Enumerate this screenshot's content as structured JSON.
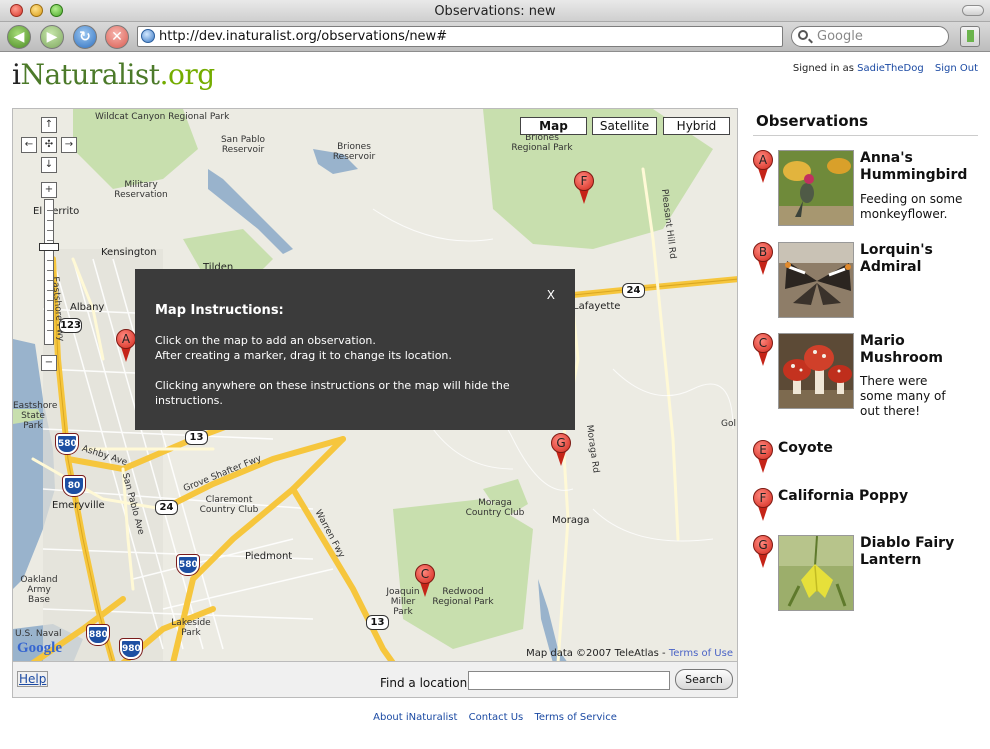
{
  "browser": {
    "window_title": "Observations: new",
    "url": "http://dev.inaturalist.org/observations/new#",
    "search_placeholder": "Google"
  },
  "header": {
    "logo_i": "i",
    "logo_nat": "Naturalist",
    "logo_org": ".org",
    "signed_in_prefix": "Signed in as",
    "username": "SadieTheDog",
    "sign_out": "Sign Out"
  },
  "map": {
    "type_buttons": [
      "Map",
      "Satellite",
      "Hybrid"
    ],
    "active_type": "Map",
    "pan": {
      "up": "↑",
      "left": "←",
      "center": "✣",
      "right": "→",
      "down": "↓"
    },
    "zoom_in": "+",
    "zoom_out": "−",
    "places": [
      "Wildcat Canyon Regional Park",
      "Briones Regional Park",
      "San Pablo Reservoir",
      "Briones Reservoir",
      "Military Reservation",
      "El Cerrito",
      "Kensington",
      "Tilden",
      "Albany",
      "Lafayette",
      "Moraga",
      "Moraga Country Club",
      "Emeryville",
      "Claremont Country Club",
      "Piedmont",
      "Joaquin Miller Park",
      "Redwood Regional Park",
      "Oakland Army Base",
      "Lakeside Park",
      "Eastshore State Park",
      "Gol",
      "Ashby Ave",
      "San Pablo Ave",
      "Grove Shafter Fwy",
      "Warren Fwy",
      "Moraga Rd",
      "Pleasant Hill Rd",
      "Eastshore Fwy",
      "U.S. Naval"
    ],
    "highways": [
      "24",
      "123",
      "13",
      "24",
      "13"
    ],
    "interstates": [
      "580",
      "80",
      "580",
      "880",
      "980"
    ],
    "markers": [
      "A",
      "C",
      "F",
      "G"
    ],
    "copyright": "Map data ©2007 TeleAtlas -",
    "terms_link": "Terms of Use",
    "google_logo": "Google",
    "overlay": {
      "title": "Map Instructions:",
      "close": "X",
      "line1": "Click on the map to add an observation.",
      "line2": "After creating a marker, drag it to change its location.",
      "line3": "Clicking anywhere on these instructions or the map will hide the instructions."
    }
  },
  "map_footer": {
    "help": "Help",
    "find_label": "Find a location:",
    "find_value": "",
    "search_button": "Search"
  },
  "footer": {
    "links": [
      "About iNaturalist",
      "Contact Us",
      "Terms of Service"
    ]
  },
  "sidebar": {
    "title": "Observations",
    "items": [
      {
        "marker": "A",
        "name": "Anna's Hummingbird",
        "description": "Feeding on some monkeyflower.",
        "photo": "hummingbird"
      },
      {
        "marker": "B",
        "name": "Lorquin's Admiral",
        "description": "",
        "photo": "butterfly"
      },
      {
        "marker": "C",
        "name": "Mario Mushroom",
        "description": "There were some many of out there!",
        "photo": "mushroom"
      },
      {
        "marker": "E",
        "name": "Coyote",
        "description": "",
        "photo": ""
      },
      {
        "marker": "F",
        "name": "California Poppy",
        "description": "",
        "photo": ""
      },
      {
        "marker": "G",
        "name": "Diablo Fairy Lantern",
        "description": "",
        "photo": "fairy-lantern"
      }
    ]
  },
  "colors": {
    "link": "#1b4aa3",
    "overlay_bg": "#3b3b3b",
    "freeway": "#f6c63d",
    "park": "#c8dfae",
    "water": "#99b3cc",
    "marker": "#d3281c"
  }
}
